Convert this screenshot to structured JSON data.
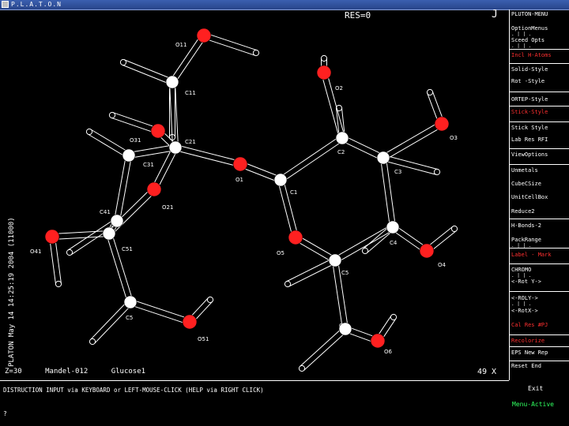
{
  "window": {
    "title": "P.L.A.T.O.N"
  },
  "viewer": {
    "res_label": "RES=0",
    "j_mark": "J",
    "side_text": "PLATON May 14 14:25:19 2004 (11000)",
    "info_left": "Z=30",
    "info_mid": "Mandel-012",
    "info_right": "Glucose1",
    "angle": "49 X",
    "console_text": "DISTRUCTION INPUT via KEYBOARD or LEFT-MOUSE-CLICK (HELP via RIGHT CLICK)",
    "prompt": "?"
  },
  "menu": {
    "items": [
      {
        "label": "PLUTON-MENU",
        "red": false
      },
      {
        "label": "OptionMenus",
        "red": false,
        "ticks": true
      },
      {
        "label": "Sceed  Opts",
        "red": false,
        "ticks": true
      },
      {
        "label": "Incl H-Atoms",
        "red": true
      },
      {
        "label": "Solid-Style",
        "red": false
      },
      {
        "label": "Rot  -Style",
        "red": false
      },
      {
        "label": "ORTEP-Style",
        "red": false
      },
      {
        "label": "Stick-Style",
        "red": true
      },
      {
        "label": "Stick Style",
        "red": false
      },
      {
        "label": "Lab Res RFI",
        "red": false
      },
      {
        "label": "ViewOptions",
        "red": false
      },
      {
        "label": "Unmetals",
        "red": false
      },
      {
        "label": "CubeCSize",
        "red": false
      },
      {
        "label": "UnitCellBox",
        "red": false
      },
      {
        "label": "Reduce2",
        "red": false
      },
      {
        "label": "H-Bonds-2",
        "red": false
      },
      {
        "label": "PackRange",
        "red": false,
        "ticks": true
      },
      {
        "label": "Label - Mark",
        "red": true
      },
      {
        "label": "CHROMO",
        "red": false,
        "ticks": true
      },
      {
        "label": "<-Rot Y->",
        "red": false
      },
      {
        "label": "<-ROLY->",
        "red": false,
        "ticks": true
      },
      {
        "label": "<-RotX->",
        "red": false
      },
      {
        "label": "Cal Res #PJ",
        "red": true
      },
      {
        "label": "Recolorize",
        "red": true
      },
      {
        "label": "EPS New Rep",
        "red": false
      },
      {
        "label": "Reset  End",
        "red": false
      }
    ],
    "exit_label": "Exit",
    "mode_label": "Menu-Active"
  },
  "molecule": {
    "atom_color": "#ffffff",
    "oxygen_color": "#ff2020",
    "atoms": [
      {
        "label": "O11",
        "element": "O"
      },
      {
        "label": "C11",
        "element": "C"
      },
      {
        "label": "O31",
        "element": "O"
      },
      {
        "label": "C21",
        "element": "C"
      },
      {
        "label": "C31",
        "element": "C"
      },
      {
        "label": "O21",
        "element": "O"
      },
      {
        "label": "C41",
        "element": "C"
      },
      {
        "label": "C51",
        "element": "C"
      },
      {
        "label": "O41",
        "element": "O"
      },
      {
        "label": "C5",
        "element": "C"
      },
      {
        "label": "O51",
        "element": "O"
      },
      {
        "label": "O1",
        "element": "O"
      },
      {
        "label": "C1",
        "element": "C"
      },
      {
        "label": "O2",
        "element": "O"
      },
      {
        "label": "C2",
        "element": "C"
      },
      {
        "label": "C3",
        "element": "C"
      },
      {
        "label": "O3",
        "element": "O"
      },
      {
        "label": "C4",
        "element": "C"
      },
      {
        "label": "O4",
        "element": "O"
      },
      {
        "label": "O5",
        "element": "O"
      },
      {
        "label": "C5",
        "element": "C"
      },
      {
        "label": "C6",
        "element": "C"
      },
      {
        "label": "O6",
        "element": "O"
      }
    ]
  }
}
